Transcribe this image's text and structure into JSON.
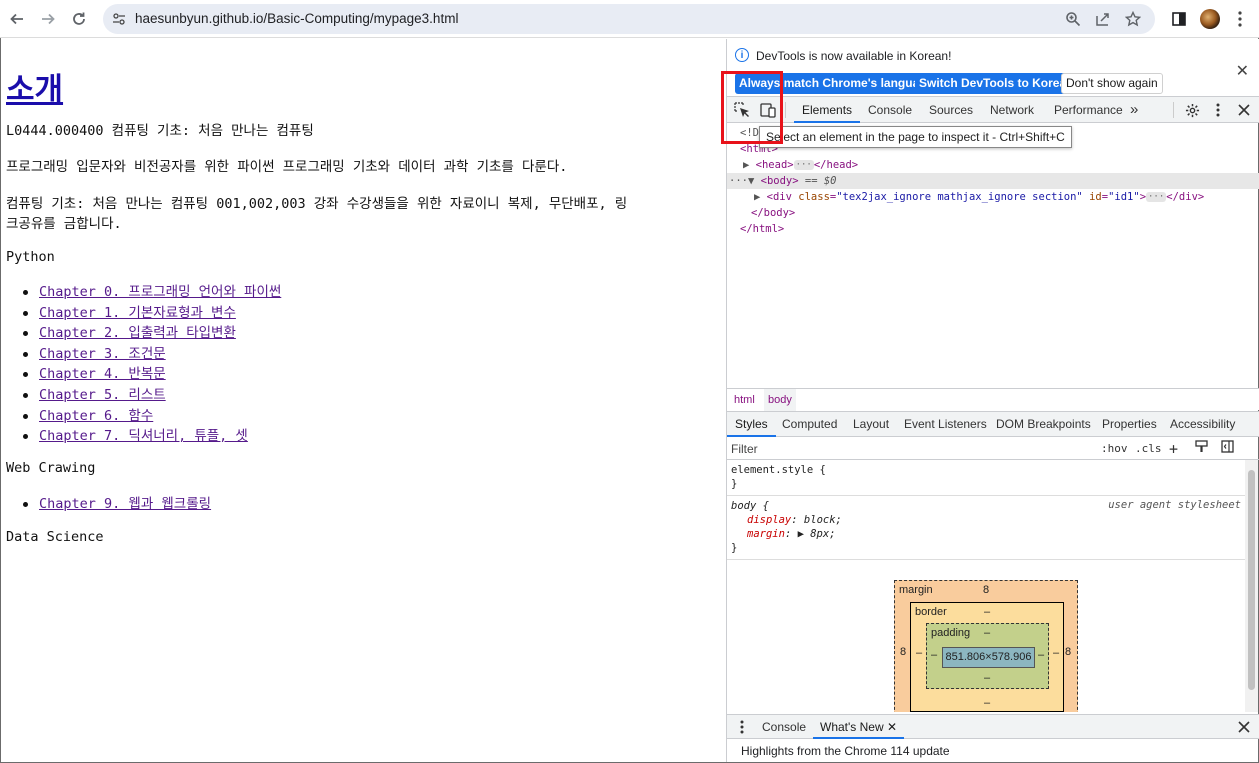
{
  "browser": {
    "url": "haesunbyun.github.io/Basic-Computing/mypage3.html"
  },
  "page": {
    "heading": "소개",
    "course_line": "L0444.000400 컴퓨팅 기초: 처음 만나는 컴퓨팅",
    "intro": "프로그래밍 입문자와 비전공자를 위한 파이썬 프로그래밍 기초와 데이터 과학 기초를 다룬다.",
    "notice_line1": "컴퓨팅 기초: 처음 만나는 컴퓨팅 001,002,003 강좌 수강생들을 위한 자료이니 복제, 무단배포, 링",
    "notice_line2": "크공유를 금합니다.",
    "section_python": "Python",
    "python_chapters": [
      "Chapter 0. 프로그래밍 언어와 파이썬",
      "Chapter 1. 기본자료형과 변수",
      "Chapter 2. 입출력과 타입변환",
      "Chapter 3. 조건문",
      "Chapter 4. 반복문",
      "Chapter 5. 리스트",
      "Chapter 6. 함수",
      "Chapter 7. 딕셔너리, 튜플, 셋"
    ],
    "section_web": "Web Crawing",
    "web_chapters": [
      "Chapter 9. 웹과 웹크롤링"
    ],
    "section_ds": "Data Science"
  },
  "devtools": {
    "infobar": {
      "message": "DevTools is now available in Korean!",
      "btn_match": "Always match Chrome's language",
      "btn_switch": "Switch DevTools to Korean",
      "btn_dismiss": "Don't show again"
    },
    "tabs": [
      "Elements",
      "Console",
      "Sources",
      "Network",
      "Performance"
    ],
    "more_tabs": "»",
    "tooltip": "Select an element in the page to inspect it - Ctrl+Shift+C",
    "dom": {
      "doctype_partial": "<!D",
      "html_open_partial": "<html>",
      "head": "<head>",
      "head_close": "</head>",
      "body": "<body>",
      "body_eq": "== $0",
      "div_open": "<div",
      "div_class_attr": "class",
      "div_class_val": "\"tex2jax_ignore mathjax_ignore section\"",
      "div_id_attr": "id",
      "div_id_val": "\"id1\"",
      "div_close": "</div>",
      "body_close": "</body>",
      "html_close": "</html>"
    },
    "breadcrumbs": [
      "html",
      "body"
    ],
    "subtabs": [
      "Styles",
      "Computed",
      "Layout",
      "Event Listeners",
      "DOM Breakpoints",
      "Properties",
      "Accessibility"
    ],
    "filter_placeholder": "Filter",
    "filter_tools": [
      ":hov",
      ".cls"
    ],
    "styles": {
      "element_style": "element.style {",
      "close_brace": "}",
      "body_selector": "body {",
      "ua_label": "user agent stylesheet",
      "display_prop": "display",
      "display_val": "block;",
      "margin_prop": "margin",
      "margin_val": "8px;"
    },
    "box_model": {
      "margin_label": "margin",
      "margin_value": "8",
      "border_label": "border",
      "border_value": "–",
      "padding_label": "padding",
      "padding_value": "–",
      "content_size": "851.806×578.906",
      "side_margin": "8",
      "dash": "–"
    },
    "drawer": {
      "tabs": [
        "Console",
        "What's New"
      ],
      "message": "Highlights from the Chrome 114 update"
    }
  }
}
